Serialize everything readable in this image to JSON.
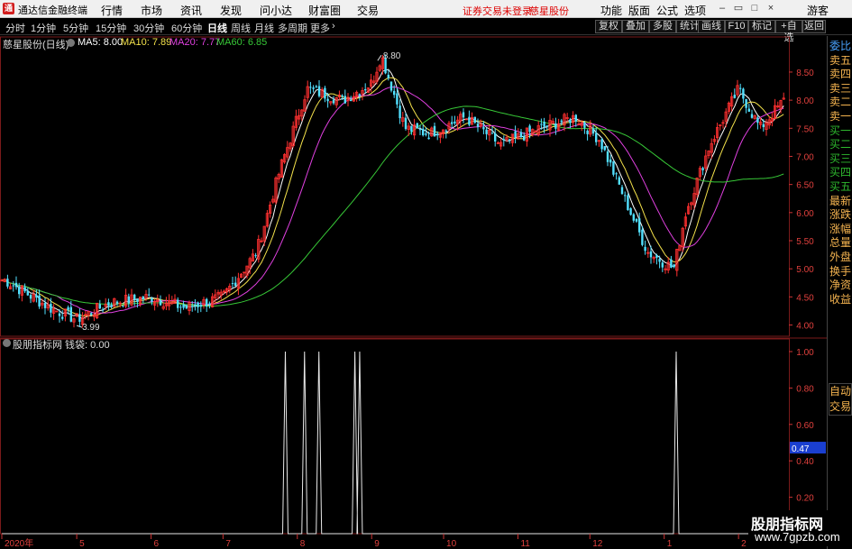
{
  "app": {
    "title": "通达信金融终端",
    "logo": "通"
  },
  "menu": [
    "行情",
    "市场",
    "资讯",
    "发现",
    "问小达",
    "财富圈",
    "交易"
  ],
  "login_status": "证券交易未登录",
  "stock_tab": "慈星股份",
  "right_menu": [
    "功能",
    "版面",
    "公式",
    "选项"
  ],
  "window_buttons": [
    "minimize-icon",
    "restore-icon",
    "maximize-icon",
    "close-icon"
  ],
  "guest": "游客",
  "periods": [
    "分时",
    "1分钟",
    "5分钟",
    "15分钟",
    "30分钟",
    "60分钟",
    "日线",
    "周线",
    "月线",
    "多周期",
    "更多"
  ],
  "active_period": "日线",
  "toolbar_buttons": [
    "复权",
    "叠加",
    "多股",
    "统计",
    "画线",
    "F10",
    "标记",
    "+自选",
    "返回"
  ],
  "side_panel": {
    "items": [
      "委比",
      "卖五",
      "卖四",
      "卖三",
      "卖二",
      "卖一",
      "买一",
      "买二",
      "买三",
      "买四",
      "买五",
      "最新",
      "涨跌",
      "涨幅",
      "总量",
      "外盘",
      "换手",
      "净资",
      "收益"
    ],
    "trade": [
      "自动",
      "交易"
    ]
  },
  "chart": {
    "title": "慈星股份(日线)",
    "ma": [
      {
        "label": "MA5: 8.00",
        "color": "#ffffff"
      },
      {
        "label": "MA10: 7.89",
        "color": "#f3e14b"
      },
      {
        "label": "MA20: 7.77",
        "color": "#e040e0"
      },
      {
        "label": "MA60: 6.85",
        "color": "#37c837"
      }
    ],
    "high_label": "8.80",
    "low_label": "3.99",
    "y_ticks": [
      "8.50",
      "8.00",
      "7.50",
      "7.00",
      "6.50",
      "6.00",
      "5.50",
      "5.00",
      "4.50",
      "4.00"
    ],
    "up_color": "#ff3030",
    "down_color": "#52e0ff"
  },
  "indicator": {
    "title": "股朋指标网  钱袋: 0.00",
    "y_ticks": [
      "1.00",
      "0.80",
      "0.60",
      "0.40",
      "0.20"
    ],
    "current_value": "0.47",
    "spikes": [
      {
        "x": "2020-07-27",
        "value": 1
      },
      {
        "x": "2020-08-04",
        "value": 1
      },
      {
        "x": "2020-08-10",
        "value": 1
      },
      {
        "x": "2020-08-25",
        "value": 1
      },
      {
        "x": "2020-08-27",
        "value": 1
      },
      {
        "x": "2021-01-06",
        "value": 1
      }
    ]
  },
  "x_axis": [
    "2020年",
    "5",
    "6",
    "7",
    "8",
    "9",
    "10",
    "11",
    "12",
    "1",
    "2"
  ],
  "watermark": {
    "title": "股朋指标网",
    "url": "www.7gpzb.com"
  },
  "chart_data": {
    "type": "candlestick",
    "title": "慈星股份(日线)",
    "y_range": [
      3.8,
      8.9
    ],
    "price_path": [
      [
        "2020-04",
        4.8
      ],
      [
        "2020-04-20",
        4.3
      ],
      [
        "2020-05-01",
        4.1
      ],
      [
        "2020-05-15",
        4.4
      ],
      [
        "2020-06-01",
        4.5
      ],
      [
        "2020-06-15",
        4.3
      ],
      [
        "2020-07-01",
        4.5
      ],
      [
        "2020-07-15",
        5.3
      ],
      [
        "2020-07-25",
        6.8
      ],
      [
        "2020-08-05",
        8.2
      ],
      [
        "2020-08-20",
        8.0
      ],
      [
        "2020-09-01",
        8.3
      ],
      [
        "2020-09-05",
        8.8
      ],
      [
        "2020-09-15",
        7.5
      ],
      [
        "2020-09-25",
        7.4
      ],
      [
        "2020-10-10",
        7.7
      ],
      [
        "2020-10-25",
        7.2
      ],
      [
        "2020-11-10",
        7.5
      ],
      [
        "2020-11-25",
        7.7
      ],
      [
        "2020-12-05",
        7.3
      ],
      [
        "2020-12-15",
        6.3
      ],
      [
        "2020-12-25",
        5.3
      ],
      [
        "2021-01-05",
        5.0
      ],
      [
        "2021-01-10",
        6.0
      ],
      [
        "2021-01-20",
        7.2
      ],
      [
        "2021-02-01",
        8.2
      ],
      [
        "2021-02-10",
        7.5
      ],
      [
        "2021-02-20",
        8.0
      ]
    ]
  }
}
